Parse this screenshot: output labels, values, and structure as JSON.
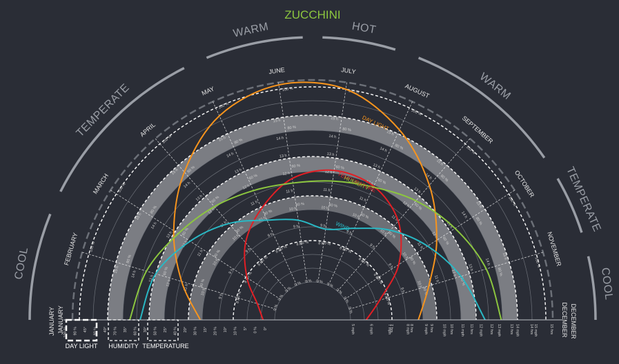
{
  "chart_data": {
    "type": "radial-line",
    "title": "ZUCCHINI",
    "seasons": [
      "COOL",
      "TEMPERATE",
      "WARM",
      "HOT",
      "WARM",
      "TEMPERATE",
      "COOL"
    ],
    "months": [
      "JANUARY",
      "FEBRUARY",
      "MARCH",
      "APRIL",
      "MAY",
      "JUNE",
      "JULY",
      "AUGUST",
      "SEPTEMBER",
      "OCTOBER",
      "NOVEMBER",
      "DECEMBER"
    ],
    "legend": [
      "DAY LIGHT",
      "HUMIDITY",
      "TEMPERATURE"
    ],
    "series": [
      {
        "name": "DAY LIGHT",
        "color": "#f7941d",
        "values": [
          9.5,
          10.6,
          11.9,
          13.3,
          14.6,
          15.2,
          15.0,
          13.9,
          12.5,
          11.1,
          9.9,
          9.2
        ],
        "scale": "hours",
        "range": [
          8,
          15
        ]
      },
      {
        "name": "TEMPERATURE",
        "color": "#e31e24",
        "values": [
          2,
          4,
          9,
          15,
          20,
          25,
          27,
          26,
          22,
          15,
          7,
          3
        ],
        "scale": "celsius",
        "range": [
          0,
          45
        ]
      },
      {
        "name": "HUMIDITY",
        "color": "#8cc63f",
        "values": [
          75,
          70,
          63,
          58,
          54,
          52,
          53,
          56,
          62,
          68,
          74,
          78
        ],
        "scale": "percent",
        "range": [
          0,
          100
        ]
      },
      {
        "name": "WIND",
        "color": "#29b8c4",
        "values": [
          12.5,
          12,
          11,
          10,
          9,
          8.5,
          8,
          8.5,
          9.5,
          10.5,
          11.5,
          12.5
        ],
        "scale": "mph",
        "range": [
          5,
          15
        ]
      }
    ],
    "tick_labels": {
      "percent": [
        "0 %",
        "10 %",
        "20 %",
        "30 %",
        "40 %",
        "50 %",
        "60 %",
        "70 %",
        "80 %",
        "90 %",
        "100 %"
      ],
      "celsius": [
        "0°",
        "5°",
        "10°",
        "15°",
        "20°",
        "25°",
        "30°",
        "35°",
        "40°",
        "45°"
      ],
      "hours": [
        "8 h",
        "9 h",
        "10 h",
        "11 h",
        "12 h",
        "13 h",
        "14 h",
        "15 h"
      ],
      "minutes": [
        "6 m",
        "7 m",
        "8 m",
        "9 m",
        "10 m",
        "11 m",
        "12 m",
        "13 m",
        "14 m"
      ],
      "mph": [
        "5 mph",
        "6 mph",
        "7 mph",
        "8 mph",
        "9 mph",
        "10 mph",
        "11 mph",
        "12 mph",
        "13 mph",
        "14 mph",
        "15 mph"
      ],
      "hrs": [
        "7 hrs",
        "8 hrs",
        "9 hrs",
        "10 hrs",
        "11 hrs",
        "12 hrs",
        "13 hrs",
        "14 hrs",
        "15 hrs"
      ]
    },
    "right_labels_top": [
      "5 mph",
      "6 mph",
      "7 mph",
      "8 mph",
      "9 mph",
      "10 mph",
      "11 mph",
      "12 mph",
      "13 mph",
      "14 mph",
      "15 mph"
    ],
    "right_labels_bottom": [
      "7 hrs",
      "8 hrs",
      "9 hrs",
      "10 hrs",
      "11 hrs",
      "12 hrs",
      "13 hrs",
      "14 hrs",
      "15 hrs"
    ],
    "left_labels": [
      "100 %",
      "90 %",
      "45°",
      "80 %",
      "40°",
      "70 %",
      "35°",
      "60 %",
      "30°",
      "50 %",
      "25°",
      "40 %",
      "20°",
      "30 %",
      "15°",
      "20 %",
      "10°",
      "10 %",
      "5°",
      "0 %",
      "0°"
    ],
    "colors": {
      "background": "#2a2d36",
      "band": "#8a8c90",
      "daylight": "#f7941d",
      "temperature": "#e31e24",
      "humidity": "#8cc63f",
      "wind": "#29b8c4",
      "title": "#8cc63f",
      "season": "#9a9ea6"
    }
  }
}
